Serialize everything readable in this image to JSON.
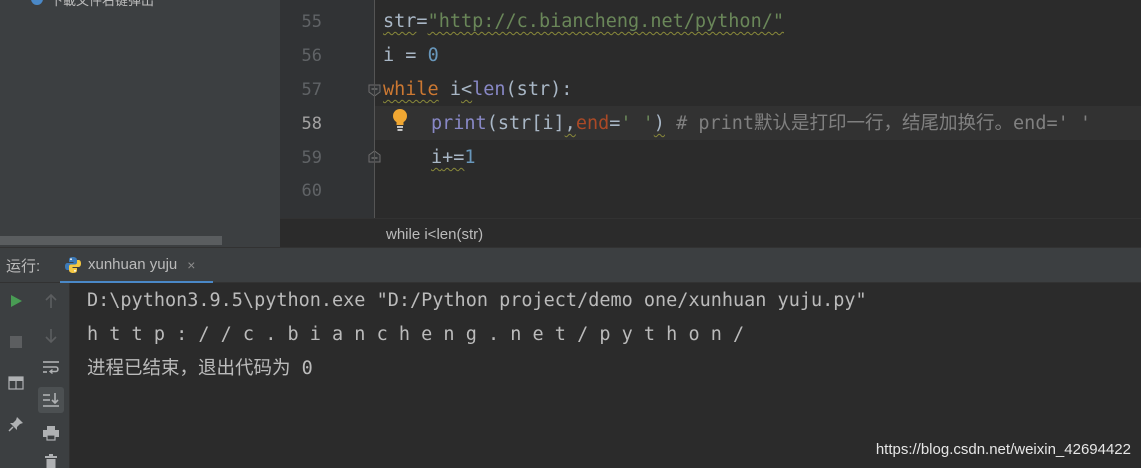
{
  "project_tree": {
    "item_label": "下載文件右键弹出",
    "scrollbar": "horizontal"
  },
  "editor": {
    "line_numbers": [
      "55",
      "56",
      "57",
      "58",
      "59",
      "60"
    ],
    "active_line": "58",
    "lines": {
      "l55": {
        "ident": "str",
        "eq": "=",
        "string": "\"http://c.biancheng.net/python/\""
      },
      "l56": {
        "ident": "i",
        "eq": " = ",
        "num": "0"
      },
      "l57": {
        "kw": "while",
        "sp": " ",
        "i": "i",
        "lt": "<",
        "fn": "len",
        "rest": "(str):"
      },
      "l58": {
        "fn": "print",
        "args_a": "(str[i]",
        "comma": ",",
        "param": "end",
        "eq": "=",
        "string": "' '",
        "close": ")",
        "comment": " # print默认是打印一行，结尾加换行。end=' '"
      },
      "l59": {
        "i": "i",
        "op": "+=",
        "num": "1"
      },
      "l60": {
        "text": ""
      }
    },
    "breadcrumb": "while i<len(str)",
    "icons": {
      "intention": "lightbulb-icon",
      "fold": "fold-marker-icon"
    }
  },
  "run_panel": {
    "label": "运行:",
    "tab": {
      "label": "xunhuan yuju",
      "icon": "python-icon",
      "close": "×"
    },
    "console_lines": [
      "D:\\python3.9.5\\python.exe \"D:/Python project/demo one/xunhuan yuju.py\"",
      "h t t p : / / c . b i a n c h e n g . n e t / p y t h o n /",
      "进程已结束，退出代码为 0"
    ],
    "toolbar_icons": [
      "run-icon",
      "stop-icon",
      "layout-icon",
      "pin-icon",
      "up-arrow-icon",
      "down-arrow-icon",
      "soft-wrap-icon",
      "scroll-to-end-icon",
      "print-icon",
      "trash-icon"
    ],
    "colors": {
      "run": "#499c54",
      "accent": "#4a88c7"
    }
  },
  "watermark": "https://blog.csdn.net/weixin_42694422"
}
